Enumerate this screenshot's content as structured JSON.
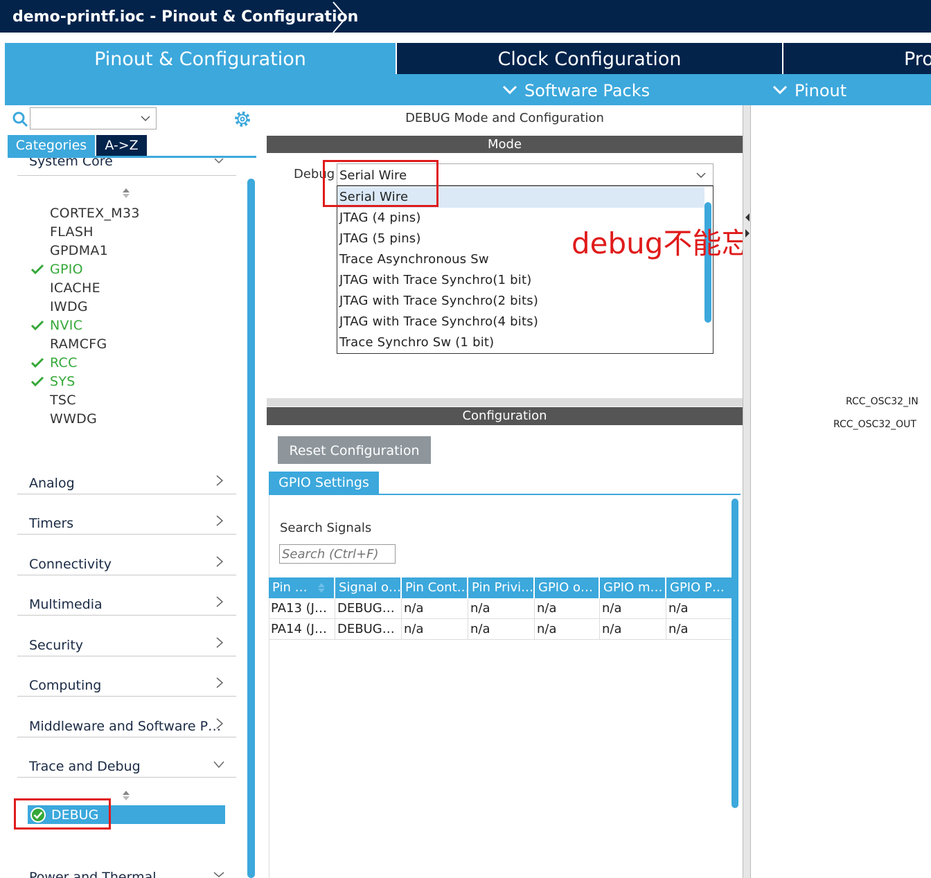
{
  "window": {
    "title": "demo-printf.ioc - Pinout & Configuration"
  },
  "tabs": [
    {
      "label": "Pinout & Configuration"
    },
    {
      "label": "Clock Configuration"
    },
    {
      "label": "Pro"
    }
  ],
  "subtabs": [
    {
      "label": "Software Packs"
    },
    {
      "label": "Pinout"
    }
  ],
  "sidebar": {
    "search_value": "",
    "view_tabs": [
      {
        "label": "Categories"
      },
      {
        "label": "A->Z"
      }
    ],
    "categories": [
      {
        "label": "System Core",
        "expanded": true
      },
      {
        "label": "Analog",
        "expanded": false
      },
      {
        "label": "Timers",
        "expanded": false
      },
      {
        "label": "Connectivity",
        "expanded": false
      },
      {
        "label": "Multimedia",
        "expanded": false
      },
      {
        "label": "Security",
        "expanded": false
      },
      {
        "label": "Computing",
        "expanded": false
      },
      {
        "label": "Middleware and Software P…",
        "expanded": false
      },
      {
        "label": "Trace and Debug",
        "expanded": true
      },
      {
        "label": "Power and Thermal",
        "expanded": true
      }
    ],
    "system_core_items": [
      {
        "label": "CORTEX_M33",
        "enabled": false
      },
      {
        "label": "FLASH",
        "enabled": false
      },
      {
        "label": "GPDMA1",
        "enabled": false
      },
      {
        "label": "GPIO",
        "enabled": true
      },
      {
        "label": "ICACHE",
        "enabled": false
      },
      {
        "label": "IWDG",
        "enabled": false
      },
      {
        "label": "NVIC",
        "enabled": true
      },
      {
        "label": "RAMCFG",
        "enabled": false
      },
      {
        "label": "RCC",
        "enabled": true
      },
      {
        "label": "SYS",
        "enabled": true
      },
      {
        "label": "TSC",
        "enabled": false
      },
      {
        "label": "WWDG",
        "enabled": false
      }
    ],
    "trace_debug_items": [
      {
        "label": "DEBUG",
        "enabled": true,
        "selected": true
      }
    ]
  },
  "mode_panel": {
    "title": "DEBUG Mode and Configuration",
    "mode_header": "Mode",
    "debug_label": "Debug",
    "debug_value": "Serial Wire",
    "debug_options": [
      "Serial Wire",
      "JTAG (4 pins)",
      "JTAG (5 pins)",
      "Trace Asynchronous Sw",
      "JTAG with Trace Synchro(1 bit)",
      "JTAG with Trace Synchro(2 bits)",
      "JTAG with Trace Synchro(4 bits)",
      "Trace Synchro Sw (1 bit)"
    ],
    "annotation": "debug不能忘"
  },
  "config_panel": {
    "header": "Configuration",
    "reset_label": "Reset Configuration",
    "settings_tab": "GPIO Settings",
    "search_label": "Search Signals",
    "search_placeholder": "Search (Ctrl+F)",
    "columns": [
      "Pin …",
      "Signal o…",
      "Pin Cont…",
      "Pin Privi…",
      "GPIO o…",
      "GPIO m…",
      "GPIO P…"
    ],
    "rows": [
      [
        "PA13 (J…",
        "DEBUG…",
        "n/a",
        "n/a",
        "n/a",
        "n/a",
        "n/a"
      ],
      [
        "PA14 (J…",
        "DEBUG…",
        "n/a",
        "n/a",
        "n/a",
        "n/a",
        "n/a"
      ]
    ]
  },
  "pinout_view": {
    "labels": [
      "RCC_OSC32_IN",
      "RCC_OSC32_OUT"
    ]
  },
  "colors": {
    "navy": "#03234b",
    "accent_blue": "#3ca8dc",
    "enabled_green": "#35a838",
    "annotation_red": "#e01b1b",
    "header_gray": "#555555"
  }
}
